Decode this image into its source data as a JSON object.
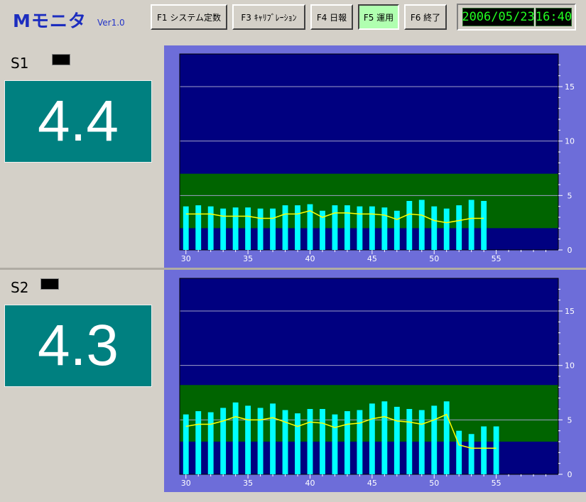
{
  "app": {
    "title": "Mモニタ",
    "version": "Ver1.0"
  },
  "toolbar": {
    "buttons": [
      {
        "key": "F1",
        "label": "F1 システム定数",
        "active": false
      },
      {
        "key": "F3",
        "label": "F3 ｷｬﾘﾌﾞﾚｰｼｮﾝ",
        "active": false
      },
      {
        "key": "F4",
        "label": "F4 日報",
        "active": false
      },
      {
        "key": "F5",
        "label": "F5 運用",
        "active": true
      },
      {
        "key": "F6",
        "label": "F6 終了",
        "active": false
      }
    ]
  },
  "clock": {
    "date": "2006/05/23",
    "time": "16:40"
  },
  "colors": {
    "plot_bg": "#000080",
    "band": "#006400",
    "bar": "#00ffff",
    "line": "#ffff00",
    "frame": "#6d6dd9",
    "value_box": "#008080",
    "lcd_text": "#22ff22"
  },
  "panels": [
    {
      "label": "S1",
      "value": "4.4",
      "chart_data": {
        "type": "bar",
        "x": [
          30,
          31,
          32,
          33,
          34,
          35,
          36,
          37,
          38,
          39,
          40,
          41,
          42,
          43,
          44,
          45,
          46,
          47,
          48,
          49,
          50,
          51,
          52,
          53,
          54
        ],
        "series": [
          {
            "values": [
              4.0,
              4.1,
              4.0,
              3.8,
              3.9,
              3.9,
              3.8,
              3.8,
              4.1,
              4.1,
              4.2,
              3.6,
              4.1,
              4.1,
              4.0,
              4.0,
              3.9,
              3.6,
              4.5,
              4.6,
              4.0,
              3.8,
              4.1,
              4.6,
              4.5
            ]
          },
          {
            "values": [
              3.3,
              3.3,
              3.3,
              3.1,
              3.1,
              3.1,
              2.9,
              2.9,
              3.3,
              3.3,
              3.6,
              3.0,
              3.4,
              3.4,
              3.3,
              3.3,
              3.2,
              2.8,
              3.3,
              3.2,
              2.7,
              2.5,
              2.7,
              2.9,
              2.9
            ]
          }
        ],
        "xlim": [
          29.5,
          60
        ],
        "ylim": [
          0,
          18
        ],
        "x_ticks": [
          30,
          35,
          40,
          45,
          50,
          55
        ],
        "y_ticks": [
          0,
          5,
          10,
          15
        ],
        "band_ranges": [
          [
            2.0,
            7.0
          ]
        ],
        "grid": true
      }
    },
    {
      "label": "S2",
      "value": "4.3",
      "chart_data": {
        "type": "bar",
        "x": [
          30,
          31,
          32,
          33,
          34,
          35,
          36,
          37,
          38,
          39,
          40,
          41,
          42,
          43,
          44,
          45,
          46,
          47,
          48,
          49,
          50,
          51,
          52,
          53,
          54,
          55
        ],
        "series": [
          {
            "values": [
              5.5,
              5.8,
              5.7,
              6.1,
              6.6,
              6.3,
              6.1,
              6.5,
              5.9,
              5.6,
              6.0,
              6.0,
              5.5,
              5.8,
              5.9,
              6.5,
              6.7,
              6.2,
              6.0,
              5.9,
              6.3,
              6.7,
              4.0,
              3.7,
              4.4,
              4.4
            ]
          },
          {
            "values": [
              4.4,
              4.6,
              4.6,
              4.9,
              5.3,
              5.0,
              5.0,
              5.2,
              4.8,
              4.4,
              4.8,
              4.7,
              4.3,
              4.6,
              4.7,
              5.1,
              5.3,
              4.9,
              4.8,
              4.6,
              5.0,
              5.5,
              2.7,
              2.4,
              2.4,
              2.4
            ]
          }
        ],
        "xlim": [
          29.5,
          60
        ],
        "ylim": [
          0,
          18
        ],
        "x_ticks": [
          30,
          35,
          40,
          45,
          50,
          55
        ],
        "y_ticks": [
          0,
          5,
          10,
          15
        ],
        "band_ranges": [
          [
            3.0,
            8.2
          ]
        ],
        "grid": true
      }
    }
  ]
}
